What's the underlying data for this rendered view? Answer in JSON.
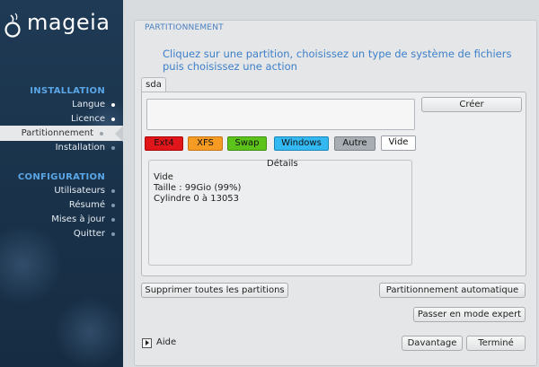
{
  "brand": {
    "name": "mageia"
  },
  "sidebar": {
    "section1": "INSTALLATION",
    "items1": [
      {
        "label": "Langue"
      },
      {
        "label": "Licence"
      },
      {
        "label": "Partitionnement",
        "active": true
      },
      {
        "label": "Installation"
      }
    ],
    "section2": "CONFIGURATION",
    "items2": [
      {
        "label": "Utilisateurs"
      },
      {
        "label": "Résumé"
      },
      {
        "label": "Mises à jour"
      },
      {
        "label": "Quitter"
      }
    ]
  },
  "main": {
    "title": "PARTITIONNEMENT",
    "instruction": "Cliquez sur une partition, choisissez un type de système de fichiers puis choisissez une action",
    "tabs": [
      {
        "label": "sda",
        "selected": true
      }
    ],
    "create_label": "Créer",
    "fs_types": [
      {
        "label": "Ext4",
        "color": "#e0161a"
      },
      {
        "label": "XFS",
        "color": "#f59a22"
      },
      {
        "label": "Swap",
        "color": "#5cc31b"
      },
      {
        "label": "Windows",
        "color": "#33b8f1"
      },
      {
        "label": "Autre",
        "color": "#a7adb3"
      },
      {
        "label": "Vide",
        "color": "#ffffff"
      }
    ],
    "details": {
      "legend": "Détails",
      "lines": [
        "Vide",
        "Taille : 99Gio (99%)",
        "Cylindre 0 à 13053"
      ]
    },
    "buttons": {
      "delete_all": "Supprimer toutes les partitions",
      "auto": "Partitionnement automatique",
      "expert": "Passer en mode expert",
      "more": "Davantage",
      "done": "Terminé"
    },
    "help_label": "Aide"
  }
}
